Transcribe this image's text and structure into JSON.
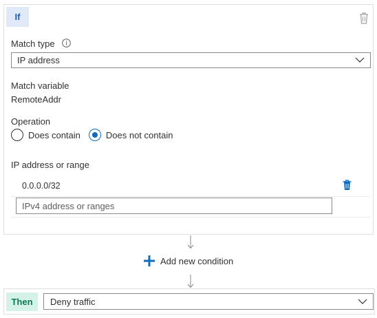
{
  "if_block": {
    "badge": "If",
    "match_type": {
      "label": "Match type",
      "selected": "IP address"
    },
    "match_variable": {
      "label": "Match variable",
      "value": "RemoteAddr"
    },
    "operation": {
      "label": "Operation",
      "options": [
        {
          "label": "Does contain",
          "selected": false
        },
        {
          "label": "Does not contain",
          "selected": true
        }
      ]
    },
    "ip_range": {
      "label": "IP address or range",
      "entries": [
        "0.0.0.0/32"
      ],
      "placeholder": "IPv4 address or ranges"
    }
  },
  "add_condition": {
    "label": "Add new condition"
  },
  "then_block": {
    "badge": "Then",
    "selected": "Deny traffic"
  },
  "icons": {
    "delete": "trash-icon",
    "info": "info-icon",
    "dropdown": "chevron-down-icon",
    "add": "plus-icon",
    "flow": "arrow-down-icon"
  },
  "colors": {
    "accent": "#0f6cbd",
    "if_badge_bg": "#dfe9f7",
    "then_badge_bg": "#d4f2e7"
  }
}
